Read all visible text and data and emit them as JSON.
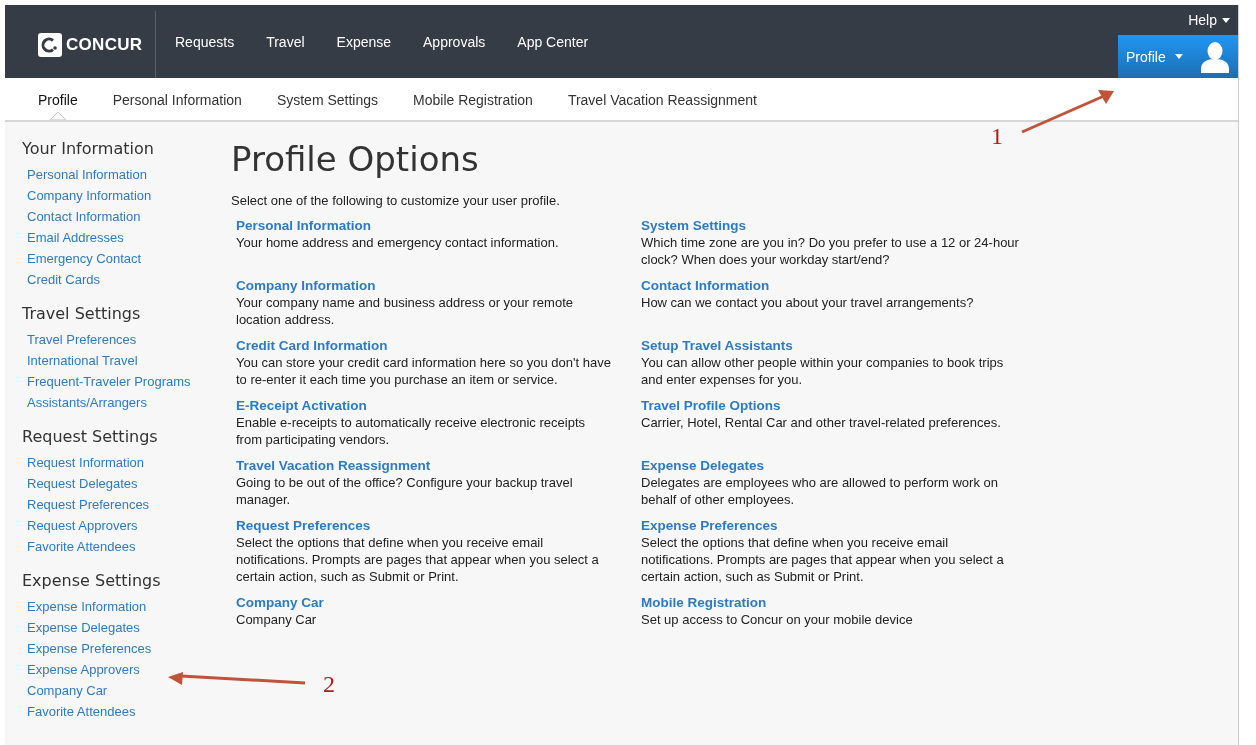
{
  "header": {
    "logo": "CONCUR",
    "nav": [
      {
        "label": "Requests",
        "selected": false
      },
      {
        "label": "Travel",
        "selected": false
      },
      {
        "label": "Expense",
        "selected": false
      },
      {
        "label": "Approvals",
        "selected": false
      },
      {
        "label": "App Center",
        "selected": false
      }
    ],
    "help": "Help",
    "profile": "Profile"
  },
  "subnav": [
    {
      "label": "Profile",
      "selected": true
    },
    {
      "label": "Personal Information",
      "selected": false
    },
    {
      "label": "System Settings",
      "selected": false
    },
    {
      "label": "Mobile Registration",
      "selected": false
    },
    {
      "label": "Travel Vacation Reassignment",
      "selected": false
    }
  ],
  "sidebar": [
    {
      "heading": "Your Information",
      "items": [
        "Personal Information",
        "Company Information",
        "Contact Information",
        "Email Addresses",
        "Emergency Contact",
        "Credit Cards"
      ]
    },
    {
      "heading": "Travel Settings",
      "items": [
        "Travel Preferences",
        "International Travel",
        "Frequent-Traveler Programs",
        "Assistants/Arrangers"
      ]
    },
    {
      "heading": "Request Settings",
      "items": [
        "Request Information",
        "Request Delegates",
        "Request Preferences",
        "Request Approvers",
        "Favorite Attendees"
      ]
    },
    {
      "heading": "Expense Settings",
      "items": [
        "Expense Information",
        "Expense Delegates",
        "Expense Preferences",
        "Expense Approvers",
        "Company Car",
        "Favorite Attendees"
      ]
    }
  ],
  "page_title": "Profile Options",
  "intro": "Select one of the following to customize your user profile.",
  "options_columns": [
    [
      {
        "title": "Personal Information",
        "description": "Your home address and emergency contact information."
      },
      {
        "title": "Company Information",
        "description": "Your company name and business address or your remote location address."
      },
      {
        "title": "Credit Card Information",
        "description": "You can store your credit card information here so you don't have to re-enter it each time you purchase an item or service."
      },
      {
        "title": "E-Receipt Activation",
        "description": "Enable e-receipts to automatically receive electronic receipts from participating vendors."
      },
      {
        "title": "Travel Vacation Reassignment",
        "description": "Going to be out of the office? Configure your backup travel manager."
      },
      {
        "title": "Request Preferences",
        "description": "Select the options that define when you receive email notifications. Prompts are pages that appear when you select a certain action, such as Submit or Print."
      },
      {
        "title": "Company Car",
        "description": "Company Car"
      }
    ],
    [
      {
        "title": "System Settings",
        "description": "Which time zone are you in? Do you prefer to use a 12 or 24-hour clock? When does your workday start/end?"
      },
      {
        "title": "Contact Information",
        "description": "How can we contact you about your travel arrangements?"
      },
      {
        "title": "Setup Travel Assistants",
        "description": "You can allow other people within your companies to book trips and enter expenses for you."
      },
      {
        "title": "Travel Profile Options",
        "description": "Carrier, Hotel, Rental Car and other travel-related preferences."
      },
      {
        "title": "Expense Delegates",
        "description": "Delegates are employees who are allowed to perform work on behalf of other employees."
      },
      {
        "title": "Expense Preferences",
        "description": "Select the options that define when you receive email notifications. Prompts are pages that appear when you select a certain action, such as Submit or Print."
      },
      {
        "title": "Mobile Registration",
        "description": "Set up access to Concur on your mobile device"
      }
    ]
  ],
  "annotations": [
    {
      "label": "1"
    },
    {
      "label": "2"
    }
  ]
}
